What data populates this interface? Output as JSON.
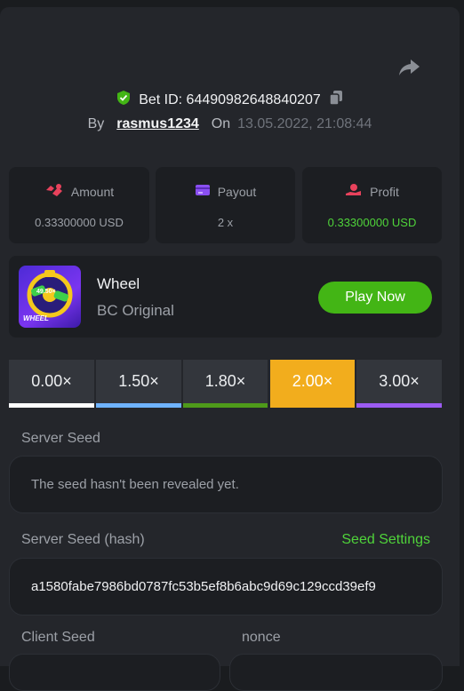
{
  "bet": {
    "id_label": "Bet ID: 64490982648840207",
    "by": "By",
    "user": "rasmus1234",
    "on": "On",
    "date": "13.05.2022, 21:08:44"
  },
  "stats": [
    {
      "label": "Amount",
      "value": "0.33300000 USD"
    },
    {
      "label": "Payout",
      "value": "2 x"
    },
    {
      "label": "Profit",
      "value": "0.33300000 USD"
    }
  ],
  "game": {
    "title": "Wheel",
    "subtitle": "BC Original",
    "play_label": "Play Now",
    "thumb_text": "WHEEL",
    "thumb_chip": "49.50×"
  },
  "multipliers": [
    {
      "label": "0.00×",
      "color": "#ffffff"
    },
    {
      "label": "1.50×",
      "color": "#6fb3ff"
    },
    {
      "label": "1.80×",
      "color": "#4e9a1a"
    },
    {
      "label": "2.00×",
      "color": "#f2ad1d",
      "active": true
    },
    {
      "label": "3.00×",
      "color": "#9c5cf2"
    }
  ],
  "seeds": {
    "server_label": "Server Seed",
    "server_value": "The seed hasn't been revealed yet.",
    "hash_label": "Server Seed (hash)",
    "settings_link": "Seed Settings",
    "hash_value": "a1580fabe7986bd0787fc53b5ef8b6abc9d69c129ccd39ef9",
    "client_label": "Client Seed",
    "nonce_label": "nonce"
  },
  "colors": {
    "accent_green": "#43b515",
    "profit_green": "#4fd33a",
    "active_orange": "#f2ad1d"
  }
}
